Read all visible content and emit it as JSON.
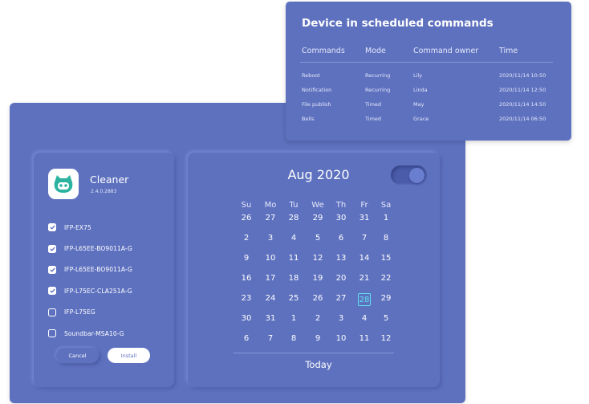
{
  "commands_panel": {
    "title": "Device in scheduled commands",
    "headers": [
      "Commands",
      "Mode",
      "Command owner",
      "Time"
    ],
    "rows": [
      [
        "Reboot",
        "Recurring",
        "Lily",
        "2020/11/14 10:50"
      ],
      [
        "Notification",
        "Recurring",
        "Linda",
        "2020/11/14 12:50"
      ],
      [
        "File publish",
        "Timed",
        "May",
        "2020/11/14 14:50"
      ],
      [
        "Bells",
        "Timed",
        "Grace",
        "2020/11/14 06:50"
      ]
    ]
  },
  "app": {
    "name": "Cleaner",
    "version": "2.4.0.2883",
    "icon": "cat-face-icon",
    "accent": "#2bb3a0"
  },
  "devices": [
    {
      "label": "IFP-EX75",
      "checked": true
    },
    {
      "label": "IFP-L65EE-BO9011A-G",
      "checked": true
    },
    {
      "label": "IFP-L65EE-BO9011A-G",
      "checked": true
    },
    {
      "label": "IFP-L75EC-CLA251A-G",
      "checked": true
    },
    {
      "label": "IFP-L75EG",
      "checked": false
    },
    {
      "label": "Soundbar-MSA10-G",
      "checked": false
    }
  ],
  "buttons": {
    "cancel": "Cancel",
    "install": "Install"
  },
  "calendar": {
    "title": "Aug 2020",
    "toggle_on": true,
    "weekdays": [
      "Su",
      "Mo",
      "Tu",
      "We",
      "Th",
      "Fr",
      "Sa"
    ],
    "weeks": [
      [
        "26",
        "27",
        "28",
        "29",
        "30",
        "31",
        "1"
      ],
      [
        "2",
        "3",
        "4",
        "5",
        "6",
        "7",
        "8"
      ],
      [
        "9",
        "10",
        "11",
        "12",
        "13",
        "14",
        "15"
      ],
      [
        "16",
        "17",
        "18",
        "19",
        "20",
        "21",
        "22"
      ],
      [
        "23",
        "24",
        "25",
        "26",
        "27",
        "28",
        "29"
      ],
      [
        "30",
        "31",
        "1",
        "2",
        "3",
        "4",
        "5"
      ],
      [
        "6",
        "7",
        "8",
        "9",
        "10",
        "11",
        "12"
      ]
    ],
    "selected_day": "28",
    "today_label": "Today"
  },
  "colors": {
    "panel": "#5e71bf",
    "selected": "#5ee0f0",
    "text": "#ffffff"
  }
}
